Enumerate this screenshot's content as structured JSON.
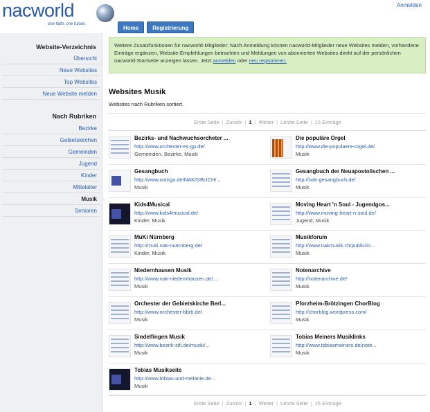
{
  "header": {
    "logo_text": "nacworld",
    "logo_tagline": "one faith. one future.",
    "login_link": "Anmelden",
    "nav": [
      "Home",
      "Registrierung"
    ]
  },
  "sidebar": {
    "heading_directory": "Website-Verzeichnis",
    "directory_items": [
      "Übersicht",
      "Neue Websites",
      "Top Websites",
      "Neue Website melden"
    ],
    "heading_categories": "Nach Rubriken",
    "category_items": [
      "Bezirke",
      "Gebietskirchen",
      "Gemeinden",
      "Jugend",
      "Kinder",
      "Mittelalter",
      "Musik",
      "Senioren"
    ],
    "active_category": "Musik"
  },
  "notice": {
    "text_before": "Weitere Zusatzfunktionen für nacworld-Mitglieder: Nach Anmeldung können nacworld-Mitglieder neue Websites melden, vorhandene Einträge ergänzen, Website-Empfehlungen betrachten und Meldungen von abonnierten Websites direkt auf der persönlichen nacworld-Startseite anzeigen lassen. Jetzt ",
    "link_login": "anmelden",
    "text_middle": " oder ",
    "link_register": "neu registrieren.",
    "text_after": ""
  },
  "section": {
    "title": "Websites Musik",
    "subtitle": "Websites nach Rubriken sortiert."
  },
  "pager": {
    "first": "Erste Seite",
    "prev": "Zurück",
    "current": "1",
    "next": "Weiter",
    "last": "Letzte Seite",
    "count": "15 Einträge"
  },
  "entries": [
    {
      "title": "Bezirks- und Nachwuchsorcheter ...",
      "url": "http://www.orchester-es-gp.de/",
      "tags": "Gemeinden, Bezirke, Musik",
      "thumb": "light"
    },
    {
      "title": "Die populäre Orgel",
      "url": "http://www.die-populaere-orgel.de/",
      "tags": "Musik",
      "thumb": "orange"
    },
    {
      "title": "Gesangbuch",
      "url": "http://www.ostriga.de/NAK/GBUCH/...",
      "tags": "Musik",
      "thumb": "blue"
    },
    {
      "title": "Gesangbuch der Neuapostolischen ...",
      "url": "http://nak-gesangbuch.de/",
      "tags": "Musik",
      "thumb": "light"
    },
    {
      "title": "Kids4Musical",
      "url": "http://www.kids4musical.de/",
      "tags": "Kinder, Musik",
      "thumb": "dark"
    },
    {
      "title": "Moving Heart 'n Soul - Jugendgos...",
      "url": "http://www.moving-heart-n-soul.de/",
      "tags": "Jugend, Musik",
      "thumb": "light"
    },
    {
      "title": "MuKi Nürnberg",
      "url": "http://muki.nak-nuernberg.de/",
      "tags": "Kinder, Musik",
      "thumb": "light"
    },
    {
      "title": "Musikforum",
      "url": "http://www.nakmusik.ch/public/in...",
      "tags": "Musik",
      "thumb": "light"
    },
    {
      "title": "Niedernhausen Musik",
      "url": "http://www.nak-niedernhausen.de/...",
      "tags": "Musik",
      "thumb": "light"
    },
    {
      "title": "Notenarchive",
      "url": "http://notenarchive.de/",
      "tags": "Musik",
      "thumb": "light"
    },
    {
      "title": "Orchester der Gebietskirche Berl...",
      "url": "http://www.orchester-bbrb.de/",
      "tags": "Musik",
      "thumb": "light"
    },
    {
      "title": "Pforzheim-Brötzingen ChorBlog",
      "url": "http://chorblog.wordpress.com/",
      "tags": "Musik",
      "thumb": "light"
    },
    {
      "title": "Sindelfingen Musik",
      "url": "http://www.bezirk-sifi.de/musik/...",
      "tags": "Musik",
      "thumb": "light"
    },
    {
      "title": "Tobias Meiners Musiklinks",
      "url": "http://www.tobiasmeiners.de/note...",
      "tags": "Musik",
      "thumb": "light"
    },
    {
      "title": "Tobias Musikseite",
      "url": "http://www.tobias-und-melanie.de...",
      "tags": "Musik",
      "thumb": "dark"
    }
  ]
}
